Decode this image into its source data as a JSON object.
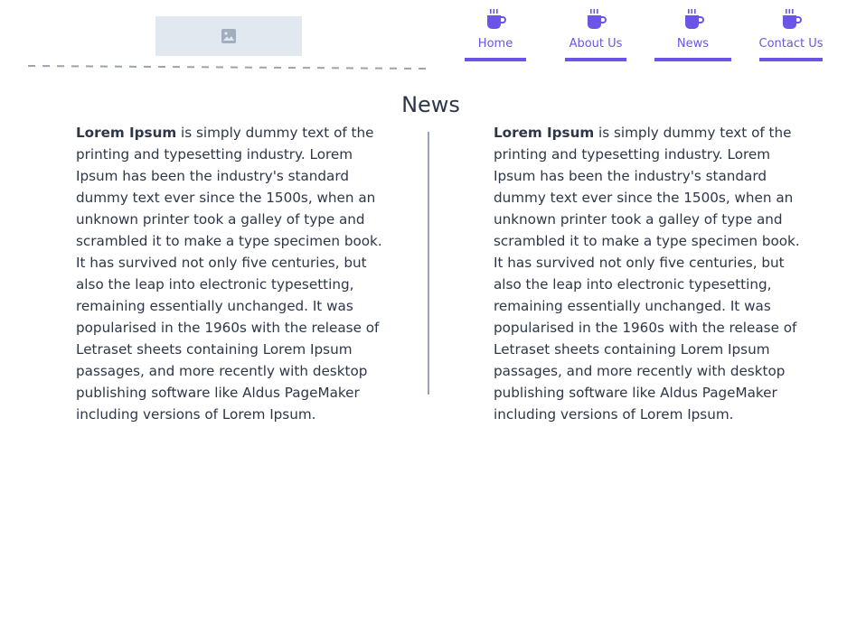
{
  "header": {
    "logo_icon": "image-placeholder-icon",
    "nav": [
      {
        "label": "Home",
        "icon": "coffee-cup-icon"
      },
      {
        "label": "About Us",
        "icon": "coffee-cup-icon"
      },
      {
        "label": "News",
        "icon": "coffee-cup-icon"
      },
      {
        "label": "Contact Us",
        "icon": "coffee-cup-icon"
      }
    ]
  },
  "main": {
    "title": "News",
    "articles": [
      {
        "lead": "Lorem Ipsum",
        "body": " is simply dummy text of the printing and typesetting industry. Lorem Ipsum has been the industry's standard dummy text ever since the 1500s, when an unknown printer took a galley of type and scrambled it to make a type specimen book. It has survived not only five centuries, but also the leap into electronic typesetting, remaining essentially unchanged. It was popularised in the 1960s with the release of Letraset sheets containing Lorem Ipsum passages, and more recently with desktop publishing software like Aldus PageMaker including versions of Lorem Ipsum."
      },
      {
        "lead": "Lorem Ipsum",
        "body": " is simply dummy text of the printing and typesetting industry. Lorem Ipsum has been the industry's standard dummy text ever since the 1500s, when an unknown printer took a galley of type and scrambled it to make a type specimen book. It has survived not only five centuries, but also the leap into electronic typesetting, remaining essentially unchanged. It was popularised in the 1960s with the release of Letraset sheets containing Lorem Ipsum passages, and more recently with desktop publishing software like Aldus PageMaker including versions of Lorem Ipsum."
      }
    ]
  },
  "colors": {
    "accent": "#6b55e6",
    "text": "#2d3748",
    "placeholder_bg": "#e2e8f0",
    "divider": "#94a3b8"
  }
}
